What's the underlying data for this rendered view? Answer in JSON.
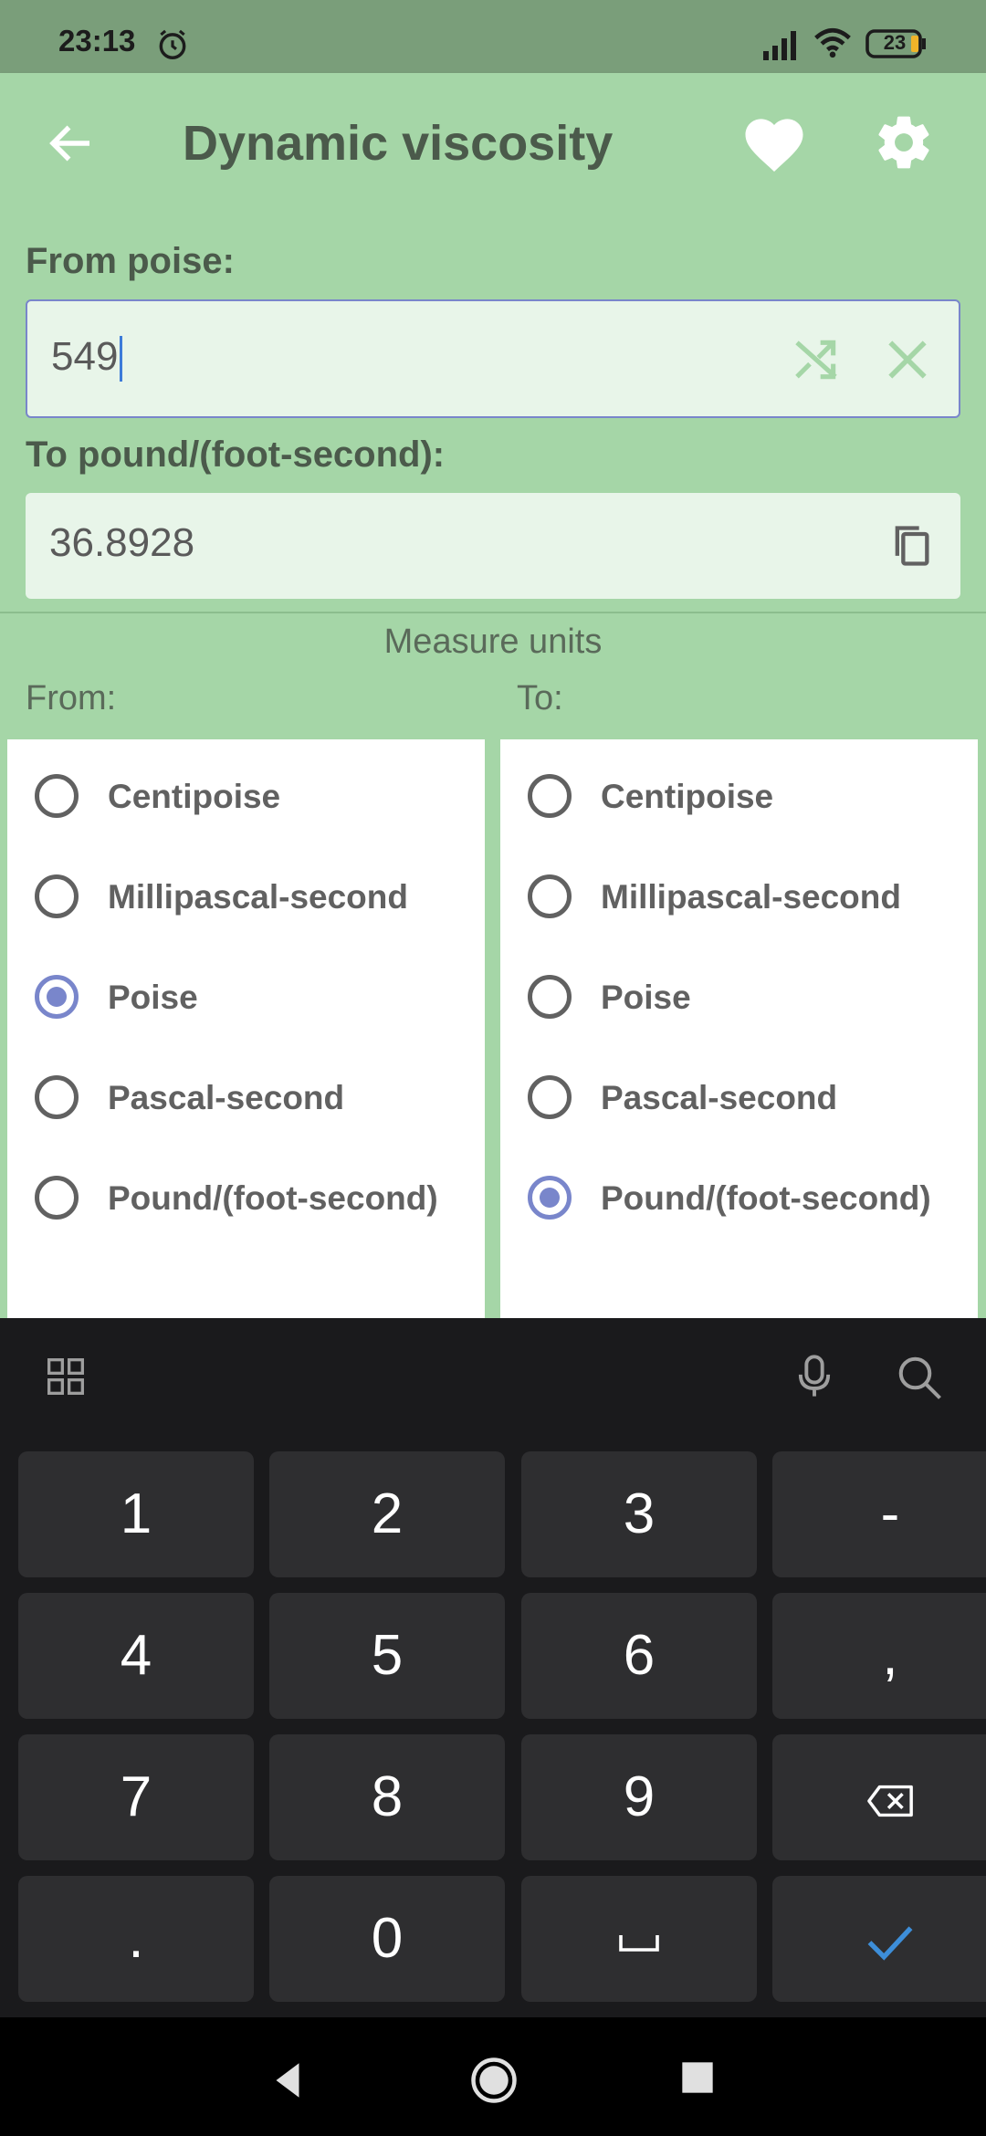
{
  "status_bar": {
    "time": "23:13",
    "battery": "23"
  },
  "app_bar": {
    "title": "Dynamic viscosity"
  },
  "form": {
    "from_label": "From poise:",
    "input_value": "549",
    "to_label": "To pound/(foot-second):",
    "output_value": "36.8928"
  },
  "units": {
    "section_title": "Measure units",
    "from_label": "From:",
    "to_label": "To:",
    "from_items": [
      {
        "label": "Centipoise",
        "checked": false
      },
      {
        "label": "Millipascal-second",
        "checked": false
      },
      {
        "label": "Poise",
        "checked": true
      },
      {
        "label": "Pascal-second",
        "checked": false
      },
      {
        "label": "Pound/(foot-second)",
        "checked": false
      }
    ],
    "to_items": [
      {
        "label": "Centipoise",
        "checked": false
      },
      {
        "label": "Millipascal-second",
        "checked": false
      },
      {
        "label": "Poise",
        "checked": false
      },
      {
        "label": "Pascal-second",
        "checked": false
      },
      {
        "label": "Pound/(foot-second)",
        "checked": true
      }
    ]
  },
  "keyboard": {
    "rows": [
      [
        "1",
        "2",
        "3",
        "-"
      ],
      [
        "4",
        "5",
        "6",
        ","
      ],
      [
        "7",
        "8",
        "9",
        "backspace"
      ],
      [
        ".",
        "0",
        "space",
        "done"
      ]
    ]
  },
  "colors": {
    "primary": "#a5d6a7",
    "accent": "#7986cb",
    "field_bg": "#e8f5e9",
    "keyboard_bg": "#1a1a1c",
    "done_check": "#3d8ed9"
  }
}
